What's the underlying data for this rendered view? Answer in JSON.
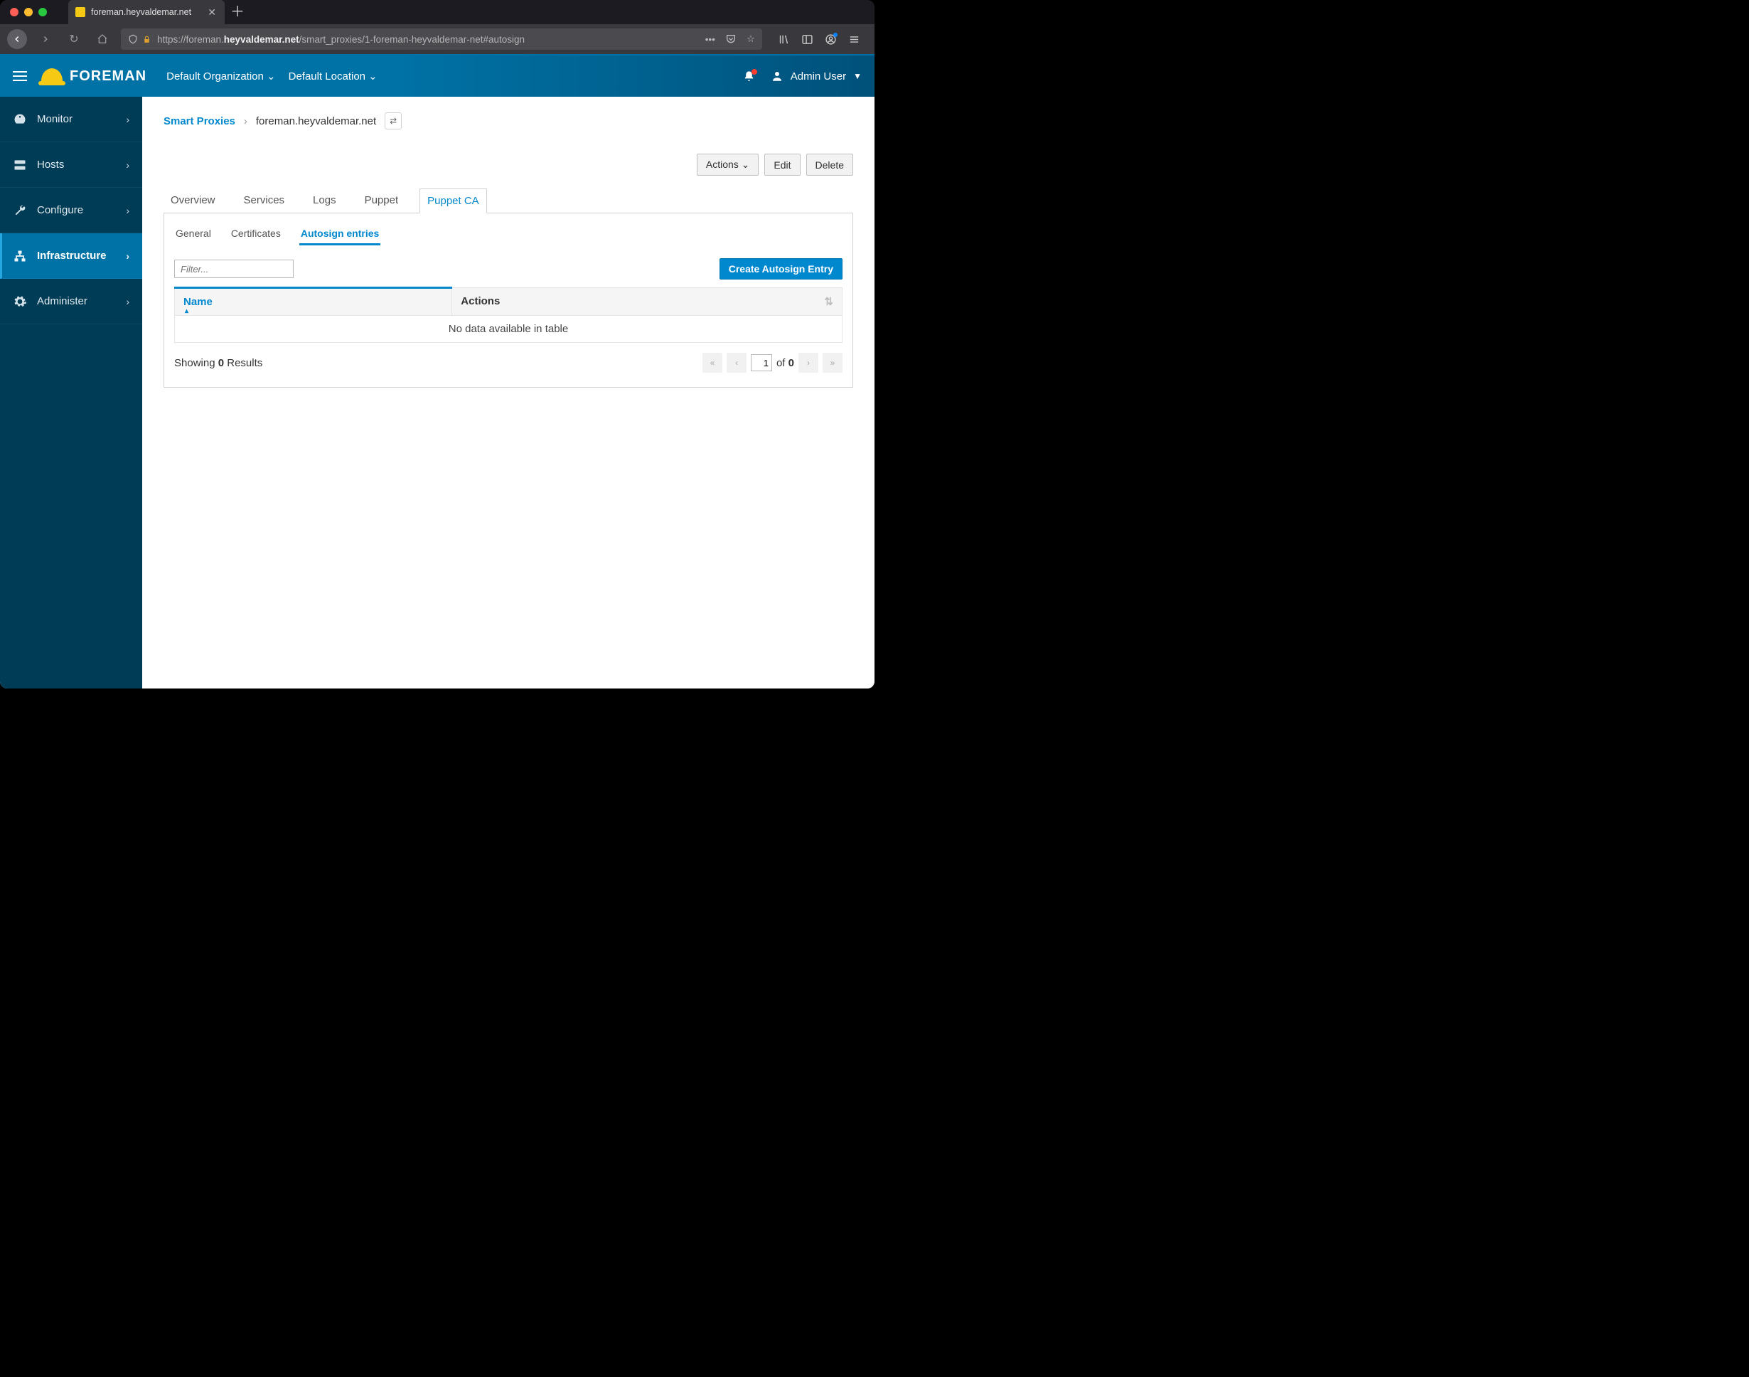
{
  "browser": {
    "tab_title": "foreman.heyvaldemar.net",
    "url_prefix": "https://foreman.",
    "url_host": "heyvaldemar.net",
    "url_path": "/smart_proxies/1-foreman-heyvaldemar-net#autosign"
  },
  "masthead": {
    "brand": "FOREMAN",
    "org": "Default Organization",
    "location": "Default Location",
    "user": "Admin User"
  },
  "sidebar": {
    "items": [
      {
        "label": "Monitor"
      },
      {
        "label": "Hosts"
      },
      {
        "label": "Configure"
      },
      {
        "label": "Infrastructure"
      },
      {
        "label": "Administer"
      }
    ]
  },
  "breadcrumb": {
    "root": "Smart Proxies",
    "current": "foreman.heyvaldemar.net"
  },
  "actions": {
    "dropdown": "Actions",
    "edit": "Edit",
    "delete": "Delete"
  },
  "tabs": {
    "items": [
      "Overview",
      "Services",
      "Logs",
      "Puppet",
      "Puppet CA"
    ]
  },
  "subtabs": {
    "items": [
      "General",
      "Certificates",
      "Autosign entries"
    ]
  },
  "table": {
    "filter_placeholder": "Filter...",
    "create_label": "Create Autosign Entry",
    "col_name": "Name",
    "col_actions": "Actions",
    "empty": "No data available in table",
    "showing_prefix": "Showing ",
    "showing_count": "0",
    "showing_suffix": " Results",
    "page": "1",
    "of": "of ",
    "total_pages": "0"
  }
}
